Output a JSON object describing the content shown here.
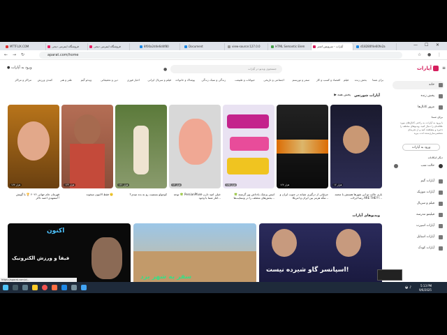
{
  "browser": {
    "tabs": [
      {
        "label": "MTTFLIX.COM"
      },
      {
        "label": "فروشگاه اینترنتی دیجی"
      },
      {
        "label": "فروشگاه اینترنتی دیجی"
      },
      {
        "label": "8f00a2d4e6d4f80"
      },
      {
        "label": "Document"
      },
      {
        "label": "view-source:127.0.0"
      },
      {
        "label": "HTML Semantic Elem"
      },
      {
        "label": "آپارات - سرویس اشتر"
      },
      {
        "label": "d18280f4e60fe2a"
      }
    ],
    "url": "aparat.com/home"
  },
  "header": {
    "logo_text": "آپارات",
    "search_placeholder": "جستجوی ویدیو در آپارات",
    "login_label": "ورود به آپارات"
  },
  "categories": [
    "برای شما",
    "بخش زنده",
    "فیلم",
    "اقتصاد و کسب و کار",
    "سفر و توریسم",
    "اجتماعی و تاریخی",
    "حیوانات و طبیعت",
    "زندگی و سبک زندگی",
    "پوشاک و خانواده",
    "فیلم و سریال ایرانی",
    "اخبار فوری",
    "دین و تحقیقاتی",
    "ویدئو گیم",
    "طنز و هنر",
    "کمدی ورزش",
    "مراکز و مراکز",
    "کارتونی و انیمیشن",
    "خلاقیت"
  ],
  "sidebar": {
    "items": [
      {
        "label": "خانه"
      },
      {
        "label": "پخش زنده"
      },
      {
        "label": "مرور کانال‌ها"
      }
    ],
    "note_title": "برای شما",
    "note_text": "با ورود به آپارات، به راحتی کانال‌های مورد علاقه‌تان را دنبال کنید، ویدیوهای مختلف را ذخیره و مشاهده کنید و از تجربه‌ای شخصی‌سازی‌شده لذت ببرید",
    "login_label": "ورود به آپارات",
    "section2_title": "دیگر امکانات",
    "dark_mode_label": "حالت شب",
    "links": [
      {
        "label": "آپارات گیم"
      },
      {
        "label": "آپارات موزیک"
      },
      {
        "label": "فیلم و سریال"
      },
      {
        "label": "فیلیمو مدرسه"
      },
      {
        "label": "آپارات اسپرت"
      },
      {
        "label": "آپارات استایل"
      },
      {
        "label": "آپارات کودک"
      }
    ]
  },
  "shorts_section": {
    "title": "آپارات شورتس",
    "play_all": "پخش همه",
    "items": [
      {
        "views": "۱۲ هزار",
        "caption": "بازی جالب تو این شهرها هستش با محمد رضا ایرلات ARE THE!!!..."
      },
      {
        "views": "۱۲۷ هزار",
        "caption": "جزئیاتی از درگیری شبانه در جنوب ایران و تنگه هرمز بین ایران و امریکا..."
      },
      {
        "views": "۱۷۵ هزار",
        "caption": "انیس پزشک یادداش پور گرسنه 🍀 بخش‌های مختلف را در وبسایت‌ها..."
      },
      {
        "views": "۱۲ هزار",
        "caption": "توجه 🍀 PersianPfuse خیلی امید دارن کنار شما با وجود..."
      },
      {
        "views": "۱۲۱ هزار",
        "caption": "کوچولو بستنیت رو به بده میدی؟"
      },
      {
        "views": "۱۲۴ هزار",
        "caption": "فقط الانیون میخوند 🙂"
      },
      {
        "views": "۱۷۷ هزار",
        "caption": "قهرمان جام جهانی ۲۰۲۶ 🏆 با گویش مشهدی احمد ذاکر!!"
      }
    ]
  },
  "videos_section": {
    "title": "ویدیوهای آپارات",
    "items": [
      {
        "overlay_text": "اسپانسر گاو شیرده نیست!"
      },
      {
        "overlay_text": "سفر به شهر یزد"
      },
      {
        "overlay_text": "فیفا و ورزش الکترونیک"
      }
    ]
  },
  "statusbar": {
    "url": "https://aparat.com/v/..."
  },
  "taskbar": {
    "time": "5:13 PM",
    "date": "9/6/2025"
  }
}
